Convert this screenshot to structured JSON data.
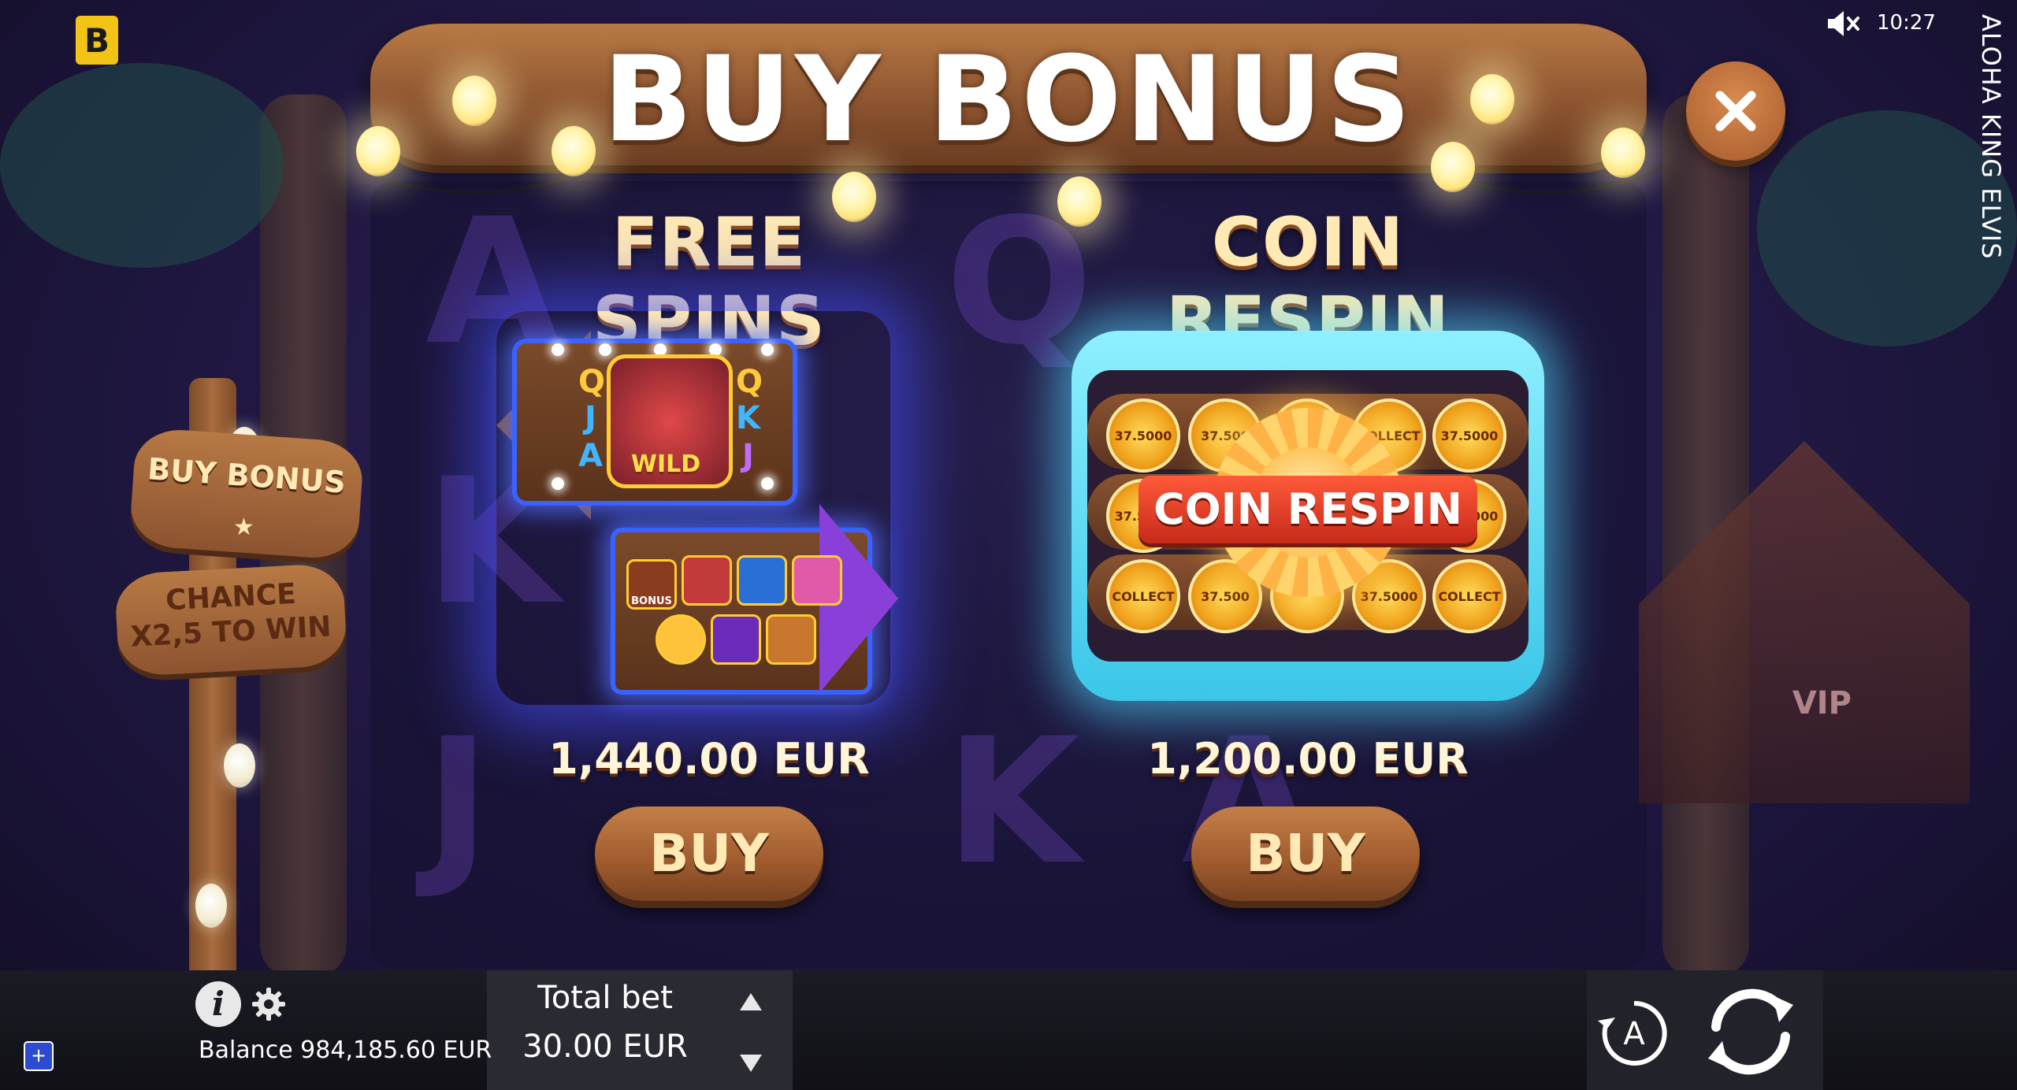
{
  "brand": {
    "logo_letter": "B"
  },
  "status": {
    "time": "10:27",
    "game_title": "ALOHA KING ELVIS"
  },
  "header": {
    "title": "BUY BONUS"
  },
  "left_sign": {
    "buy_bonus": "BUY BONUS",
    "chance_line1": "CHANCE",
    "chance_line2": "X2,5 TO WIN"
  },
  "free_spins": {
    "title": "FREE SPINS",
    "price": "1,440.00 EUR",
    "buy_label": "BUY",
    "art": {
      "wild_label": "WILD",
      "bonus_label": "BONUS",
      "symbols": [
        "Q",
        "J",
        "A",
        "Q",
        "K",
        "J"
      ]
    }
  },
  "coin_respin": {
    "title": "COIN RESPIN",
    "price": "1,200.00 EUR",
    "buy_label": "BUY",
    "art": {
      "banner": "COIN RESPIN",
      "coins_top": [
        "37.5000",
        "37.500",
        "",
        "COLLECT",
        "37.5000"
      ],
      "coins_mid": [
        "37.5000",
        "",
        "",
        "",
        "37.5000"
      ],
      "coins_bot": [
        "COLLECT",
        "37.500",
        "",
        "37.5000",
        "COLLECT"
      ]
    }
  },
  "background": {
    "letters": [
      "A",
      "Q",
      "K",
      "J",
      "K",
      "A"
    ],
    "hut_label": "VIP"
  },
  "bottom_bar": {
    "balance": "Balance 984,185.60 EUR",
    "total_bet_label": "Total bet",
    "total_bet_value": "30.00 EUR",
    "autoplay_letter": "A",
    "plus_symbol": "+"
  },
  "colors": {
    "accent_wood": "#9e5a2d",
    "free_spins_glow": "#3a62ff",
    "coin_respin_glow": "#3bc6e8",
    "title_text": "#ffe9b5"
  }
}
